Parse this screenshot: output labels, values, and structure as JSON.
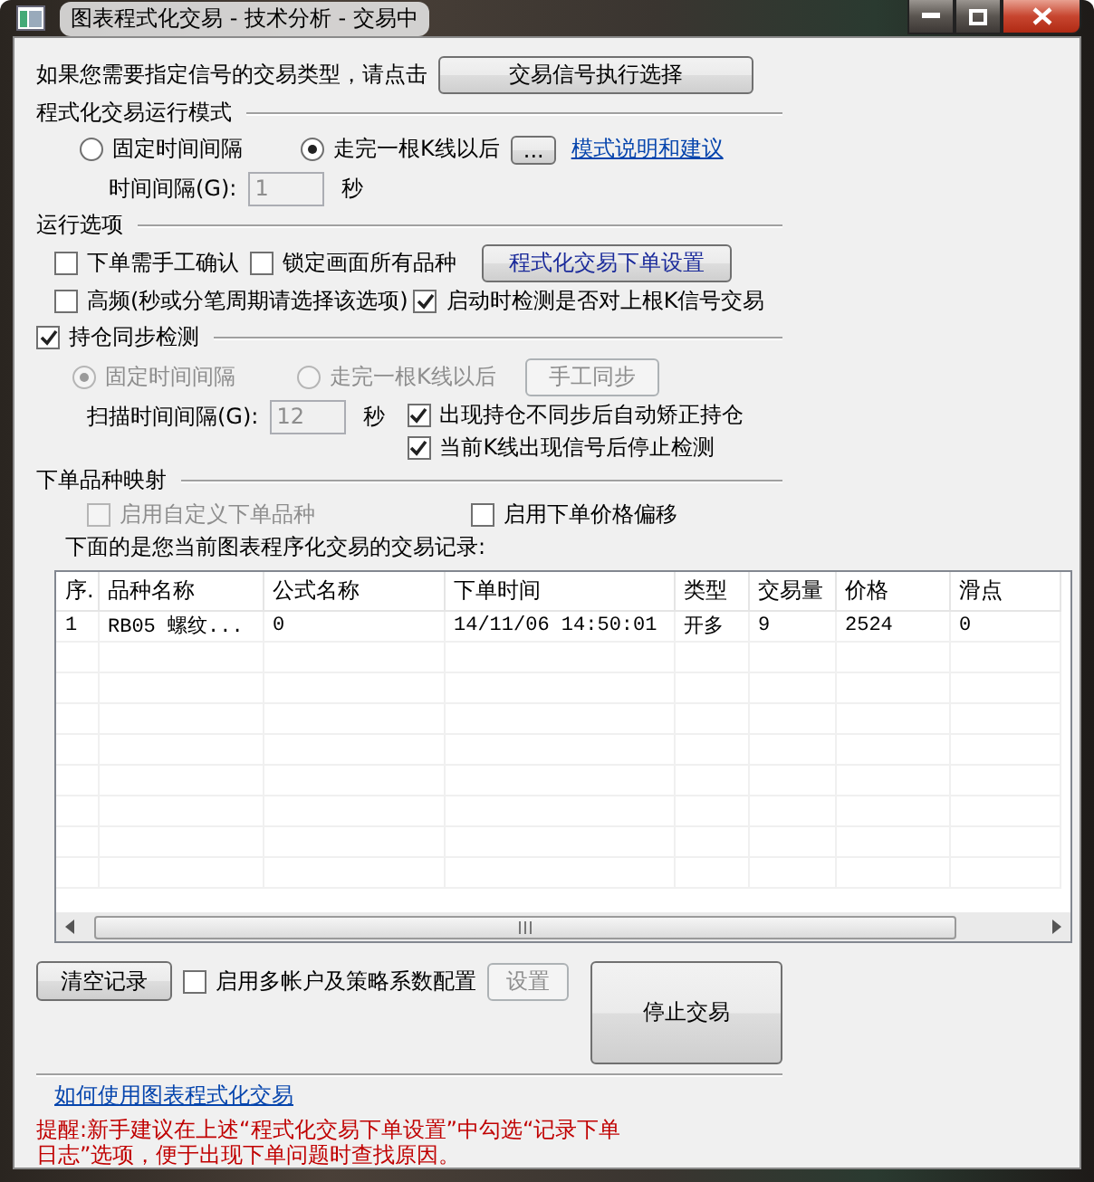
{
  "window": {
    "title": "图表程式化交易 - 技术分析 - 交易中"
  },
  "signal_prompt": {
    "text": "如果您需要指定信号的交易类型，请点击",
    "button": "交易信号执行选择"
  },
  "run_mode": {
    "title": "程式化交易运行模式",
    "options": [
      {
        "label": "固定时间间隔",
        "selected": false
      },
      {
        "label": "走完一根K线以后",
        "selected": true
      }
    ],
    "more_button": "...",
    "link": "模式说明和建议",
    "interval_label": "时间间隔(G):",
    "interval_value": "1",
    "interval_disabled": true,
    "unit": "秒"
  },
  "run_options": {
    "title": "运行选项",
    "order_settings_button": "程式化交易下单设置",
    "checkboxes": [
      {
        "label": "下单需手工确认",
        "checked": false
      },
      {
        "label": "锁定画面所有品种",
        "checked": false
      },
      {
        "label": "高频(秒或分笔周期请选择该选项)",
        "checked": false
      },
      {
        "label": "启动时检测是否对上根K信号交易",
        "checked": true
      }
    ]
  },
  "position_sync": {
    "title": "持仓同步检测",
    "checked": true,
    "options": [
      {
        "label": "固定时间间隔",
        "selected": true,
        "disabled": true
      },
      {
        "label": "走完一根K线以后",
        "selected": false,
        "disabled": true
      }
    ],
    "sync_button": {
      "label": "手工同步",
      "disabled": true
    },
    "scan_label": "扫描时间间隔(G):",
    "scan_value": "12",
    "scan_disabled": true,
    "unit": "秒",
    "checkboxes": [
      {
        "label": "出现持仓不同步后自动矫正持仓",
        "checked": true
      },
      {
        "label": "当前K线出现信号后停止检测",
        "checked": true
      }
    ]
  },
  "symbol_mapping": {
    "title": "下单品种映射",
    "checkboxes": [
      {
        "label": "启用自定义下单品种",
        "checked": false,
        "disabled": true
      },
      {
        "label": "启用下单价格偏移",
        "checked": false,
        "disabled": false
      }
    ]
  },
  "records": {
    "caption": "下面的是您当前图表程序化交易的交易记录:",
    "columns": [
      "序.",
      "品种名称",
      "公式名称",
      "下单时间",
      "类型",
      "交易量",
      "价格",
      "滑点"
    ],
    "rows": [
      [
        "1",
        "RB05 螺纹...",
        "0",
        "14/11/06 14:50:01",
        "开多",
        "9",
        "2524",
        "0"
      ]
    ]
  },
  "bottom": {
    "clear_button": "清空记录",
    "multi_account": {
      "label": "启用多帐户及策略系数配置",
      "checked": false
    },
    "settings_button": {
      "label": "设置",
      "disabled": true
    },
    "stop_button": "停止交易"
  },
  "help_link": "如何使用图表程式化交易",
  "reminder": "提醒:新手建议在上述“程式化交易下单设置”中勾选“记录下单日志”选项，便于出现下单问题时查找原因。"
}
